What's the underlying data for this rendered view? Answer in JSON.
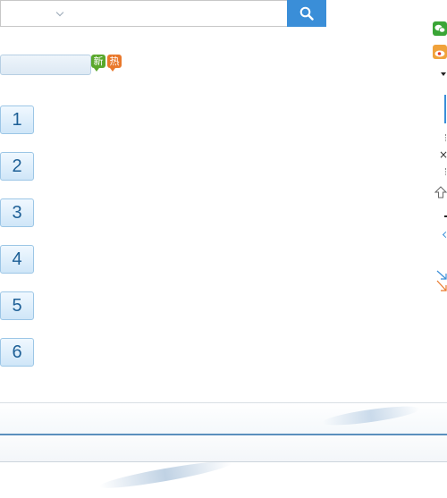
{
  "search": {
    "value": "",
    "placeholder": ""
  },
  "badges": {
    "new": "新",
    "hot": "热"
  },
  "list": [
    "1",
    "2",
    "3",
    "4",
    "5",
    "6"
  ],
  "rail": {
    "icons": [
      "wechat-icon",
      "weibo-icon",
      "caret-down-icon",
      "close-icon",
      "up-arrow-icon",
      "collapse-arrow-icon",
      "expand-arrow-icon"
    ],
    "close": "×"
  },
  "colors": {
    "accent": "#3a8ed8",
    "number_text": "#1d5f96",
    "badge_new": "#5aa82d",
    "badge_hot": "#e9782b",
    "separator": "#5b8fbd"
  }
}
